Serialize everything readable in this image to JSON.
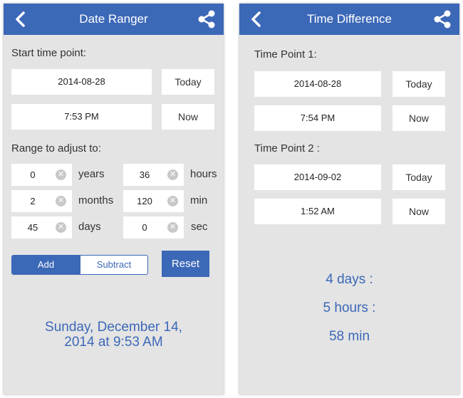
{
  "colors": {
    "accent": "#3c68b8",
    "background": "#e4e4e4",
    "field": "#ffffff"
  },
  "left": {
    "title": "Date Ranger",
    "start_label": "Start time point:",
    "date_value": "2014-08-28",
    "today_label": "Today",
    "time_value": "7:53 PM",
    "now_label": "Now",
    "range_label": "Range to adjust to:",
    "years_value": "0",
    "years_unit": "years",
    "months_value": "2",
    "months_unit": "months",
    "days_value": "45",
    "days_unit": "days",
    "hours_value": "36",
    "hours_unit": "hours",
    "min_value": "120",
    "min_unit": "min",
    "sec_value": "0",
    "sec_unit": "sec",
    "add_label": "Add",
    "subtract_label": "Subtract",
    "reset_label": "Reset",
    "result_line1": "Sunday, December 14,",
    "result_line2": "2014 at 9:53 AM"
  },
  "right": {
    "title": "Time Difference",
    "tp1_label": "Time Point 1:",
    "tp1_date": "2014-08-28",
    "tp1_today": "Today",
    "tp1_time": "7:54 PM",
    "tp1_now": "Now",
    "tp2_label": "Time Point 2 :",
    "tp2_date": "2014-09-02",
    "tp2_today": "Today",
    "tp2_time": "1:52 AM",
    "tp2_now": "Now",
    "result_days": "4 days :",
    "result_hours": "5 hours :",
    "result_min": "58 min"
  },
  "icons": {
    "back": "chevron-left-icon",
    "share": "share-icon",
    "clear": "clear-icon"
  }
}
